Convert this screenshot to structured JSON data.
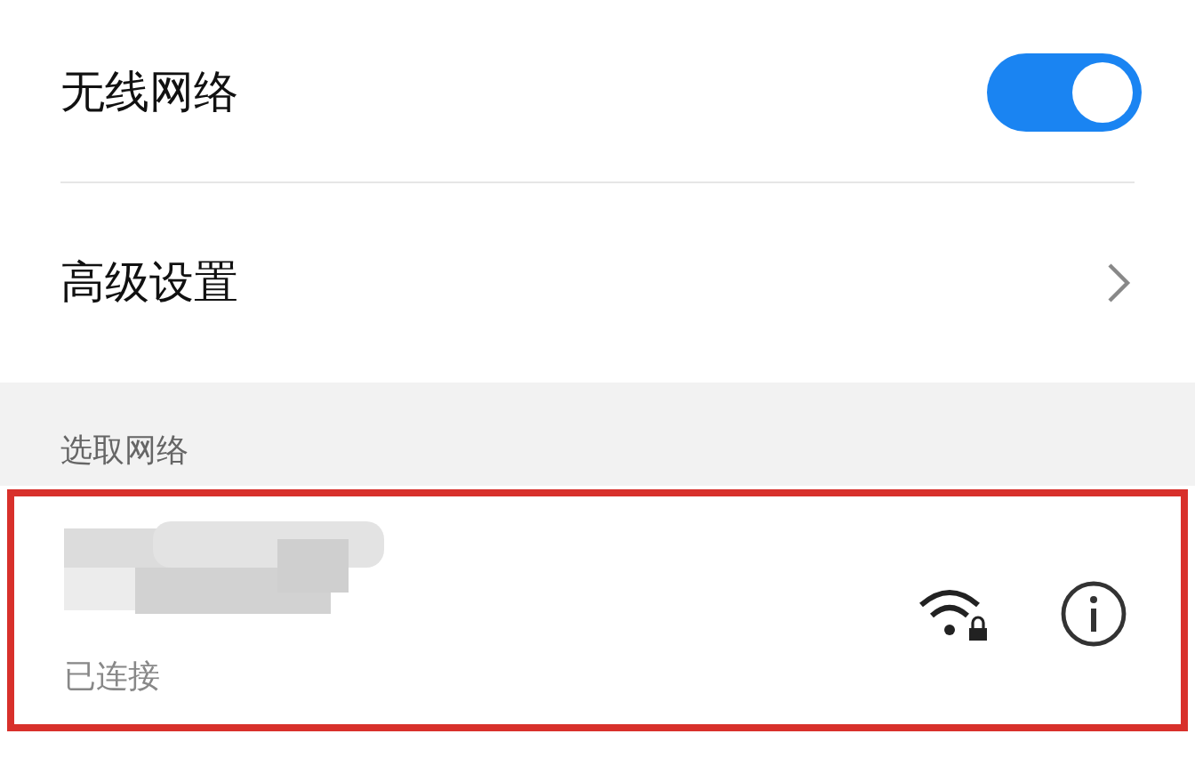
{
  "wireless": {
    "title": "无线网络",
    "on": true
  },
  "advanced": {
    "label": "高级设置"
  },
  "section": {
    "title": "选取网络"
  },
  "networks": [
    {
      "status": "已连接",
      "highlighted": true,
      "locked": true
    }
  ]
}
